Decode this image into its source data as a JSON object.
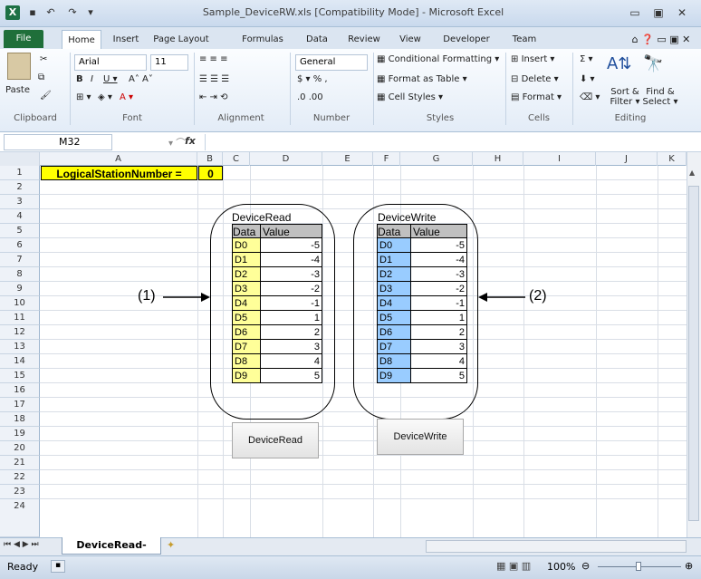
{
  "window": {
    "title": "Sample_DeviceRW.xls [Compatibility Mode] - Microsoft Excel",
    "app_icon": "X",
    "minimize": "▭",
    "restore": "▣",
    "close": "✕"
  },
  "ribbon_tabs": [
    "File",
    "Home",
    "Insert",
    "Page Layout",
    "Formulas",
    "Data",
    "Review",
    "View",
    "Developer",
    "Team"
  ],
  "ribbon": {
    "font_name": "Arial",
    "font_size": "11",
    "number_format": "General",
    "paste": "Paste",
    "conditional_formatting": "Conditional Formatting ▾",
    "format_as_table": "Format as Table ▾",
    "cell_styles": "Cell Styles ▾",
    "insert": "Insert ▾",
    "delete": "Delete ▾",
    "format": "Format ▾",
    "sort_filter": "Sort & Filter ▾",
    "find_select": "Find & Select ▾",
    "groups": [
      "Clipboard",
      "Font",
      "Alignment",
      "Number",
      "Styles",
      "Cells",
      "Editing"
    ]
  },
  "formula_bar": {
    "name_box": "M32",
    "fx": "fx",
    "value": ""
  },
  "columns": [
    "A",
    "B",
    "C",
    "D",
    "E",
    "F",
    "G",
    "H",
    "I",
    "J",
    "K"
  ],
  "rows": [
    "1",
    "2",
    "3",
    "4",
    "5",
    "6",
    "7",
    "8",
    "9",
    "10",
    "11",
    "12",
    "13",
    "14",
    "15",
    "16",
    "17",
    "18",
    "19",
    "20",
    "21",
    "22",
    "23",
    "24"
  ],
  "sheet": {
    "a1": "LogicalStationNumber =",
    "b1": "0",
    "read_table": {
      "title": "DeviceRead",
      "header": [
        "Data",
        "Value"
      ],
      "rows": [
        [
          "D0",
          "-5"
        ],
        [
          "D1",
          "-4"
        ],
        [
          "D2",
          "-3"
        ],
        [
          "D3",
          "-2"
        ],
        [
          "D4",
          "-1"
        ],
        [
          "D5",
          "1"
        ],
        [
          "D6",
          "2"
        ],
        [
          "D7",
          "3"
        ],
        [
          "D8",
          "4"
        ],
        [
          "D9",
          "5"
        ]
      ]
    },
    "write_table": {
      "title": "DeviceWrite",
      "header": [
        "Data",
        "Value"
      ],
      "rows": [
        [
          "D0",
          "-5"
        ],
        [
          "D1",
          "-4"
        ],
        [
          "D2",
          "-3"
        ],
        [
          "D3",
          "-2"
        ],
        [
          "D4",
          "-1"
        ],
        [
          "D5",
          "1"
        ],
        [
          "D6",
          "2"
        ],
        [
          "D7",
          "3"
        ],
        [
          "D8",
          "4"
        ],
        [
          "D9",
          "5"
        ]
      ]
    },
    "read_button": "DeviceRead",
    "write_button": "DeviceWrite",
    "callout_1": "(1)",
    "callout_2": "(2)"
  },
  "sheet_tab": "DeviceRead-Write",
  "status": {
    "ready": "Ready",
    "zoom": "100%"
  },
  "colors": {
    "a1_fill": "#ffff00",
    "read_data_fill": "#ffff99",
    "write_data_fill": "#99ccff",
    "header_fill": "#c0c0c0"
  }
}
